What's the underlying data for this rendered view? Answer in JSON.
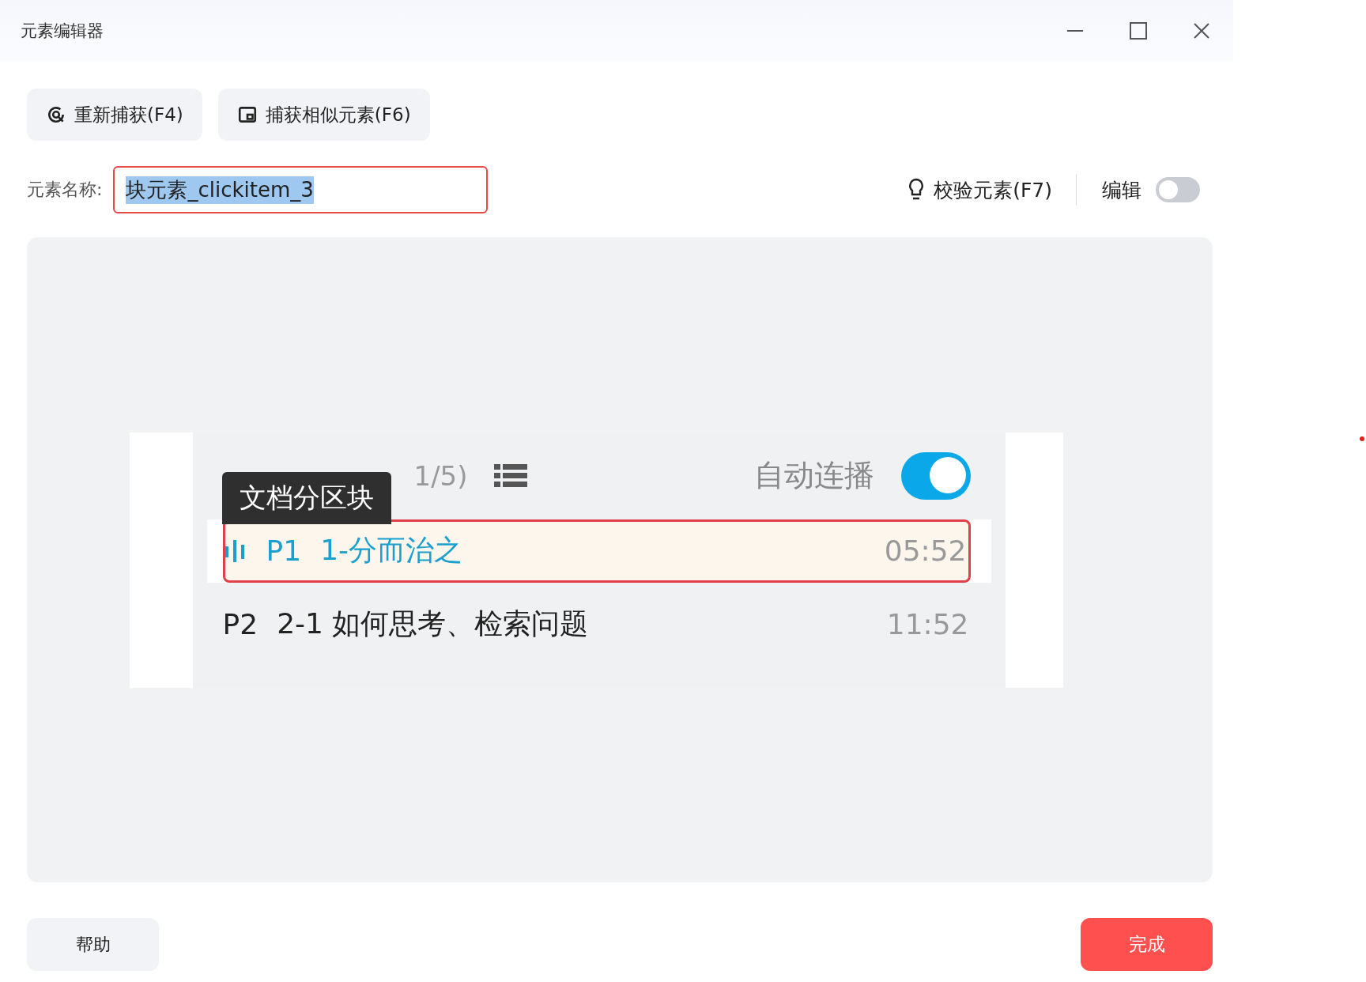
{
  "window": {
    "title": "元素编辑器"
  },
  "toolbar": [
    {
      "label": "重新捕获(F4)"
    },
    {
      "label": "捕获相似元素(F6)"
    }
  ],
  "name_field": {
    "label": "元素名称:",
    "value": "块元素_clickitem_3",
    "text_selected": true
  },
  "validate_button": {
    "label": "校验元素(F7)"
  },
  "edit_toggle": {
    "label": "编辑",
    "on": false
  },
  "preview": {
    "count": "1/5)",
    "autoplay": {
      "label": "自动连播",
      "on": true
    },
    "tooltip": "文档分区块",
    "episodes": [
      {
        "number": "P1",
        "title": "1-分而治之",
        "duration": "05:52",
        "selected": true
      },
      {
        "number": "P2",
        "title": "2-1 如何思考、检索问题",
        "duration": "11:52",
        "selected": false
      }
    ]
  },
  "footer": {
    "help": "帮助",
    "done": "完成"
  }
}
